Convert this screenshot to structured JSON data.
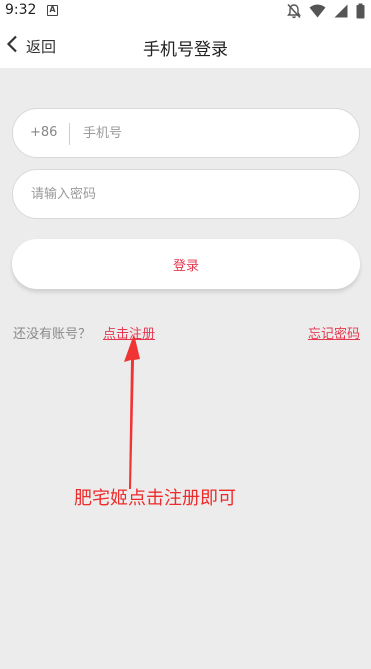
{
  "status_bar": {
    "time": "9:32",
    "notification_letter": "A",
    "icons": [
      "notifications-off-icon",
      "wifi-icon",
      "signal-icon",
      "battery-icon"
    ]
  },
  "nav": {
    "back_label": "返回",
    "title": "手机号登录"
  },
  "form": {
    "country_code": "+86",
    "phone_placeholder": "手机号",
    "password_placeholder": "请输入密码",
    "login_label": "登录"
  },
  "links": {
    "no_account_text": "还没有账号？",
    "register_label": "点击注册",
    "forgot_label": "忘记密码"
  },
  "annotation": {
    "text": "肥宅姬点击注册即可"
  },
  "colors": {
    "accent": "#e53950",
    "annotation": "#ee2b2b",
    "background": "#ececec"
  }
}
